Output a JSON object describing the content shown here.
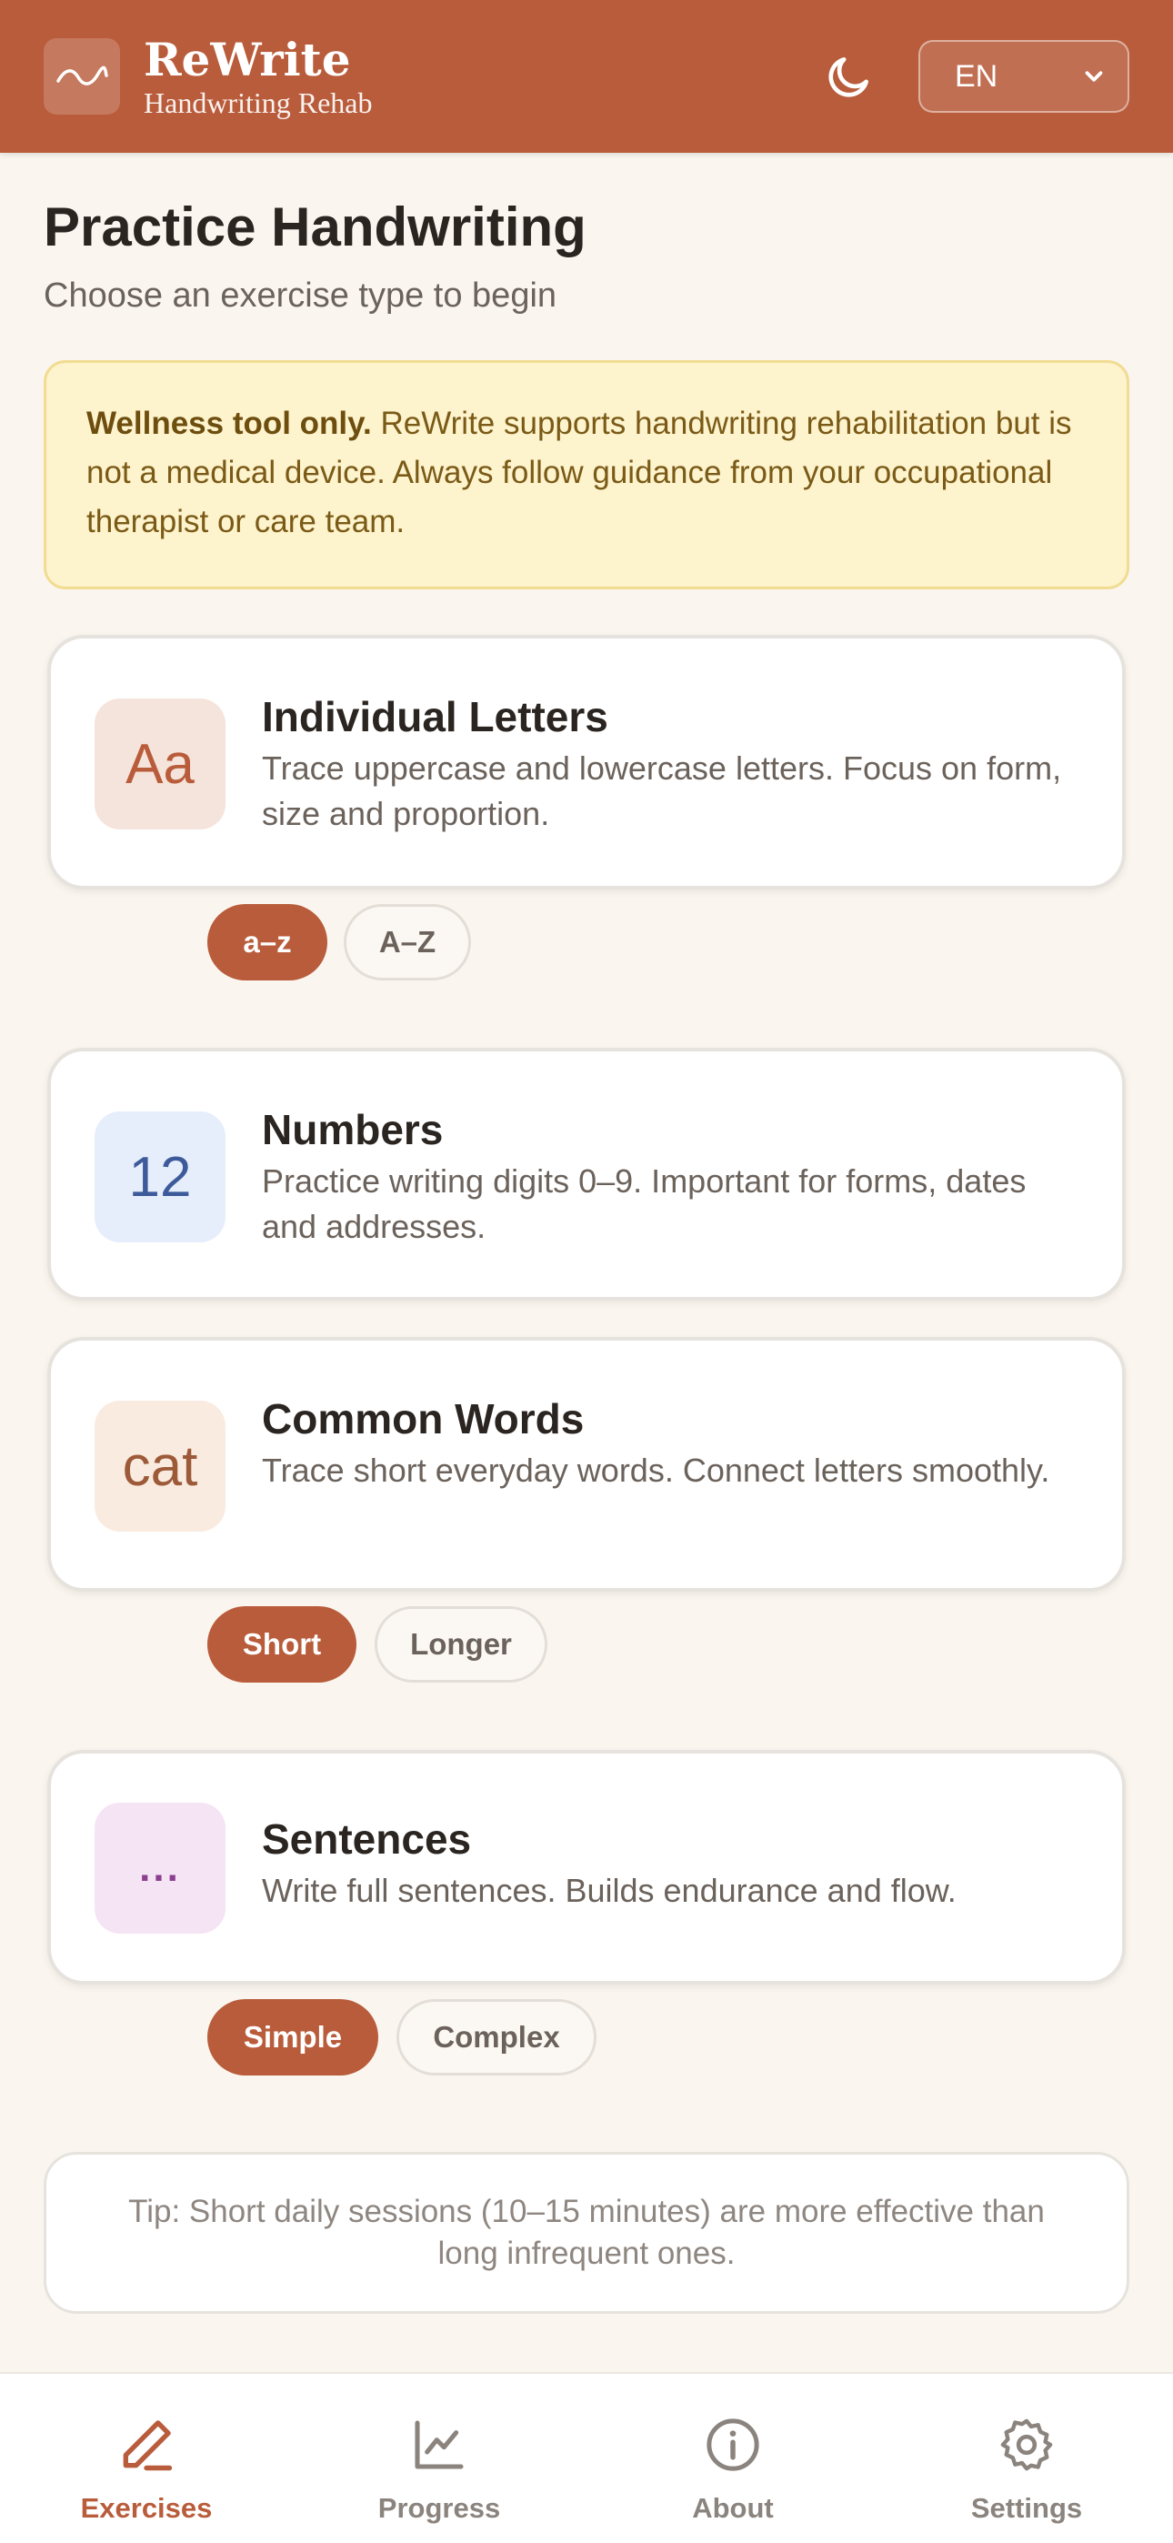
{
  "header": {
    "app_name": "ReWrite",
    "app_subtitle": "Handwriting Rehab",
    "language": "EN"
  },
  "page": {
    "title": "Practice Handwriting",
    "subtitle": "Choose an exercise type to begin"
  },
  "notice": {
    "bold": "Wellness tool only.",
    "text": " ReWrite supports handwriting rehabilitation but is not a medical device. Always follow guidance from your occupational therapist or care team."
  },
  "exercises": [
    {
      "icon_text": "Aa",
      "title": "Individual Letters",
      "description": "Trace uppercase and lowercase letters. Focus on form, size and proportion.",
      "options": [
        {
          "label": "a–z",
          "active": true
        },
        {
          "label": "A–Z",
          "active": false
        }
      ]
    },
    {
      "icon_text": "12",
      "title": "Numbers",
      "description": "Practice writing digits 0–9. Important for forms, dates and addresses.",
      "options": []
    },
    {
      "icon_text": "cat",
      "title": "Common Words",
      "description": "Trace short everyday words. Connect letters smoothly.",
      "options": [
        {
          "label": "Short",
          "active": true
        },
        {
          "label": "Longer",
          "active": false
        }
      ]
    },
    {
      "icon_text": "...",
      "title": "Sentences",
      "description": "Write full sentences. Builds endurance and flow.",
      "options": [
        {
          "label": "Simple",
          "active": true
        },
        {
          "label": "Complex",
          "active": false
        }
      ]
    }
  ],
  "tip": "Tip: Short daily sessions (10–15 minutes) are more effective than long infrequent ones.",
  "nav": [
    {
      "label": "Exercises",
      "icon": "pencil-icon",
      "active": true
    },
    {
      "label": "Progress",
      "icon": "chart-icon",
      "active": false
    },
    {
      "label": "About",
      "icon": "info-icon",
      "active": false
    },
    {
      "label": "Settings",
      "icon": "gear-icon",
      "active": false
    }
  ],
  "colors": {
    "brand": "#b95c3b",
    "background": "#faf6ef",
    "notice_bg": "#fdf3cd",
    "nav_inactive": "#8b847e"
  }
}
